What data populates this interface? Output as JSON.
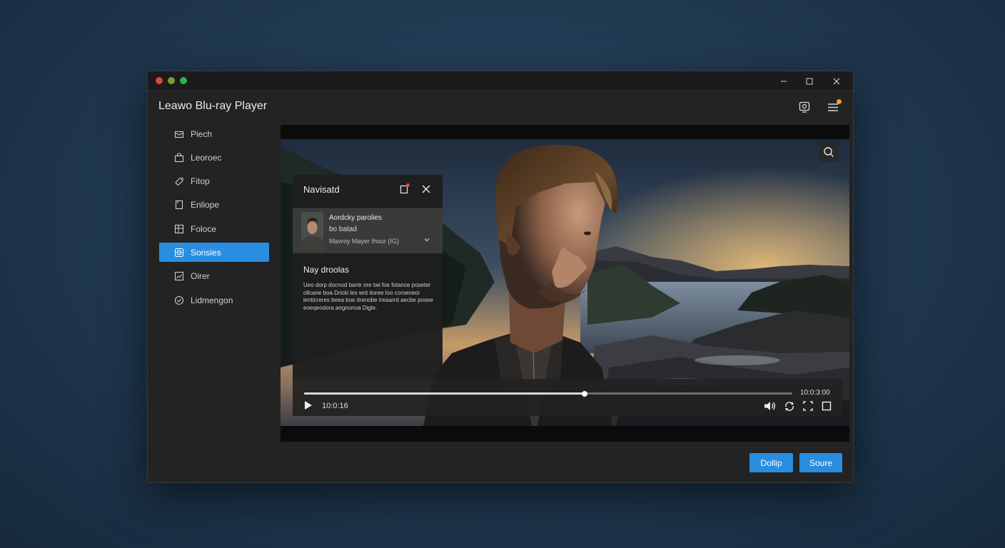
{
  "window": {
    "app_title": "Leawo Blu-ray Player",
    "controls": {
      "minimize": "—",
      "maximize": "☐",
      "close": "✕"
    }
  },
  "header": {
    "cast_icon": "cast-icon",
    "menu_icon": "hamburger-menu-icon",
    "notification_color": "#f0a020"
  },
  "sidebar": {
    "items": [
      {
        "label": "Piech",
        "icon": "inbox-icon",
        "active": false
      },
      {
        "label": "Leoroec",
        "icon": "bag-icon",
        "active": false
      },
      {
        "label": "Fitop",
        "icon": "tag-icon",
        "active": false
      },
      {
        "label": "Enliope",
        "icon": "document-icon",
        "active": false
      },
      {
        "label": "Foloce",
        "icon": "grid-icon",
        "active": false
      },
      {
        "label": "Sonsies",
        "icon": "globe-icon",
        "active": true
      },
      {
        "label": "Oirer",
        "icon": "chart-icon",
        "active": false
      },
      {
        "label": "Lidmengon",
        "icon": "circle-check-icon",
        "active": false
      }
    ]
  },
  "player": {
    "zoom_icon": "search-icon",
    "nav_panel": {
      "title": "Navisatd",
      "card": {
        "line1": "Aordcky parolies",
        "line2": "bo batad",
        "line3": "Mavroy Mayer Ihour (IG)"
      },
      "subtitle": "Nay droolas",
      "body": "Ueo dorp docnod bantr ore twi foe fotance poseter ollcane boa Dricki les wnt itoree loo coroeneoi lenticreres beea boe itrenobe treaarrd aecbe posee eoeqeodora angnonoa Digle."
    },
    "controls": {
      "current_time": "10:0:16",
      "total_time": "10:0:3:00",
      "progress": 0.575
    }
  },
  "footer": {
    "button_primary": "Dollip",
    "button_secondary": "Soure"
  },
  "colors": {
    "accent": "#2a8ee0",
    "window_bg": "#232323"
  }
}
